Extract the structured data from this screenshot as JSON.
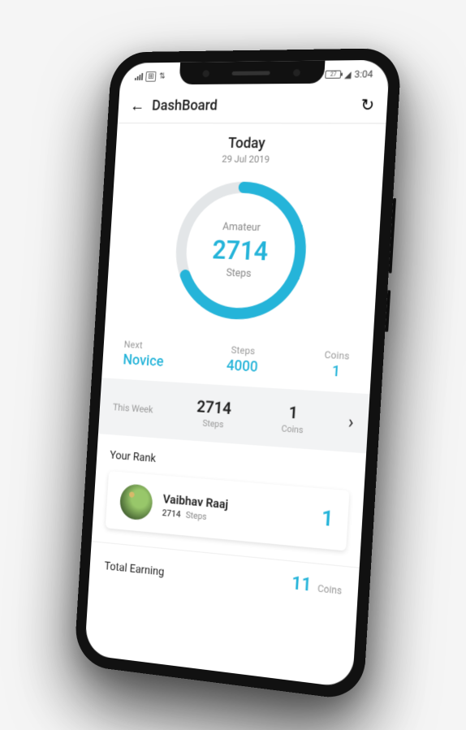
{
  "status": {
    "battery": "27",
    "time": "3:04",
    "carrier_icon": "signal-icon",
    "sim_icon": "sim-icon",
    "battery_icon": "battery-icon",
    "cell_icon": "cell-icon"
  },
  "header": {
    "title": "DashBoard"
  },
  "today": {
    "label": "Today",
    "date": "29 Jul 2019"
  },
  "ring": {
    "level_label": "Amateur",
    "steps": "2714",
    "steps_label": "Steps",
    "progress_fraction": 0.68
  },
  "next": {
    "next_lbl": "Next",
    "next_val": "Novice",
    "steps_lbl": "Steps",
    "steps_val": "4000",
    "coins_lbl": "Coins",
    "coins_val": "1"
  },
  "week": {
    "label": "This Week",
    "steps": "2714",
    "steps_lbl": "Steps",
    "coins": "1",
    "coins_lbl": "Coins"
  },
  "rank": {
    "title": "Your Rank",
    "name": "Vaibhav Raaj",
    "steps": "2714",
    "steps_lbl": "Steps",
    "position": "1"
  },
  "earning": {
    "title": "Total Earning",
    "value": "11",
    "unit": "Coins"
  },
  "chart_data": {
    "type": "pie",
    "title": "Amateur – Steps",
    "values": [
      2714,
      1286
    ],
    "categories": [
      "completed",
      "remaining"
    ],
    "total": 4000,
    "center_value": 2714,
    "center_label": "Steps"
  }
}
